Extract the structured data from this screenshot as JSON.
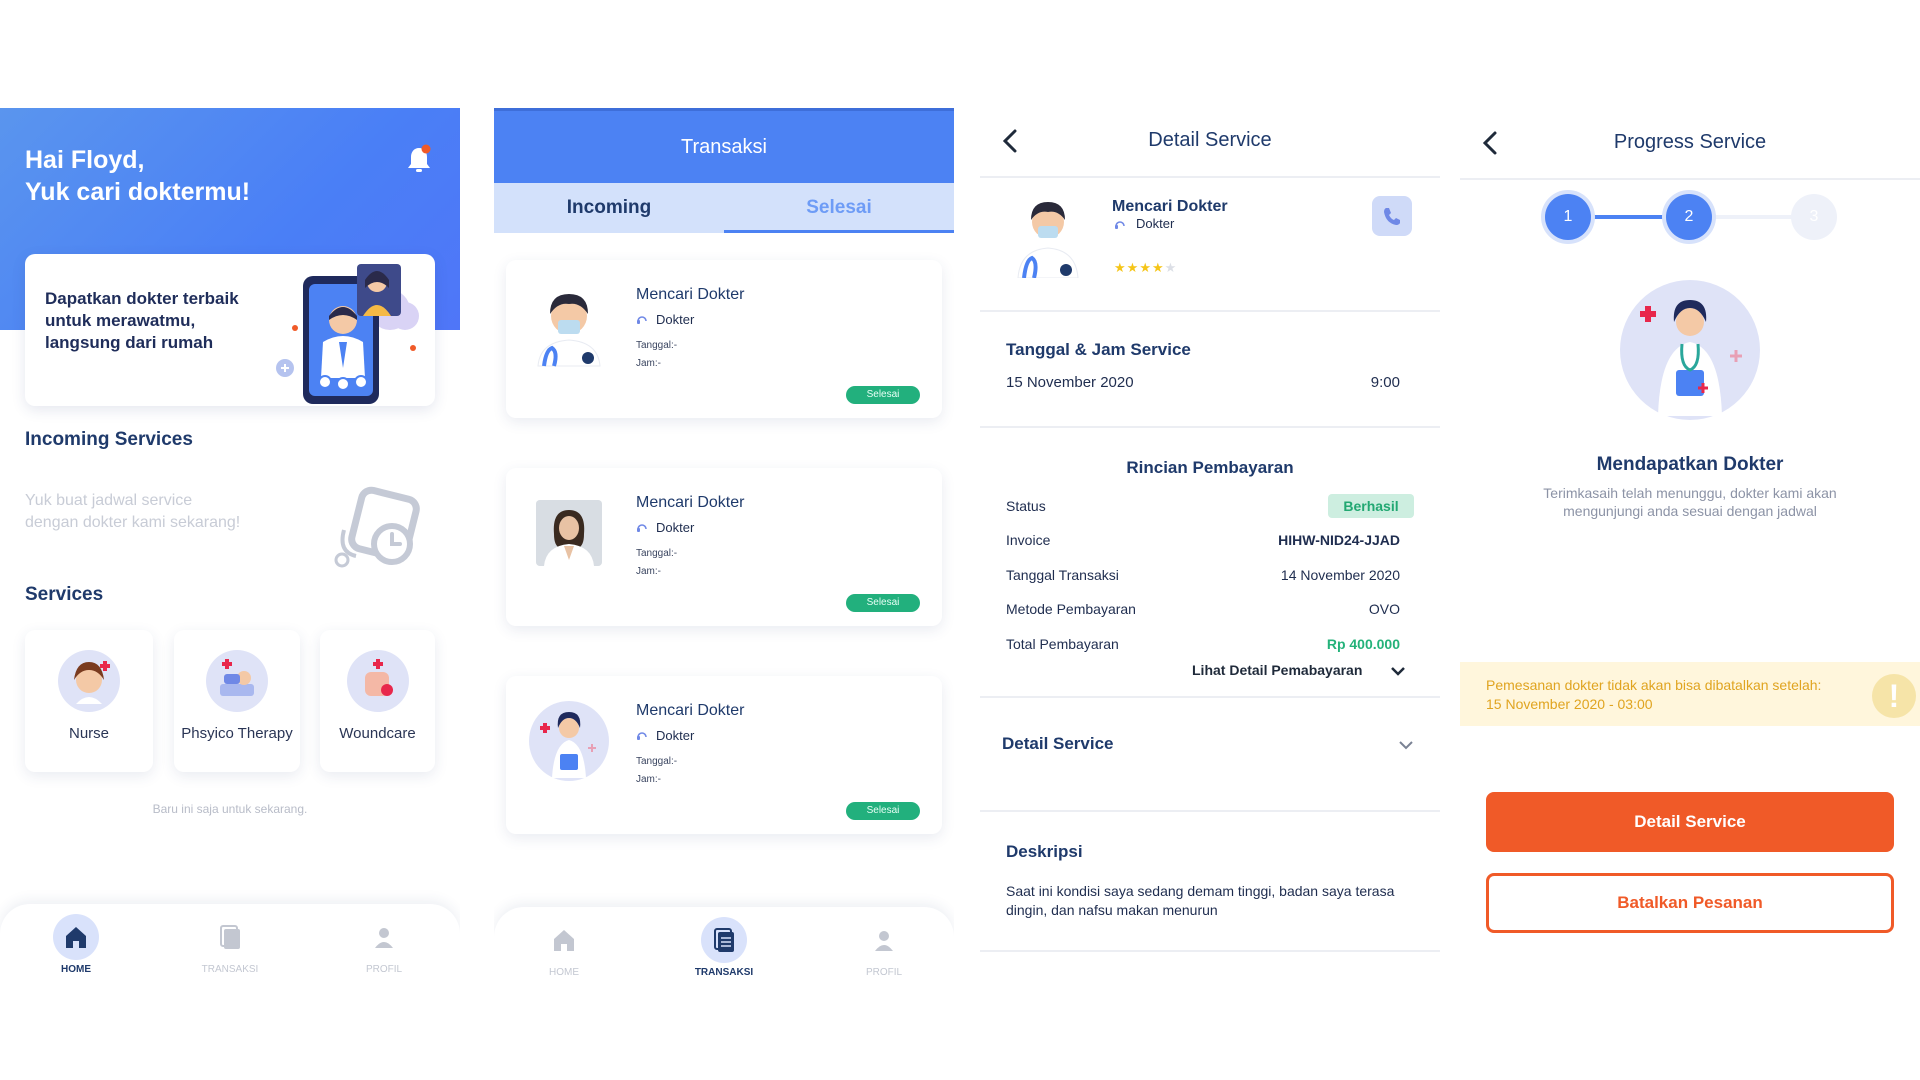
{
  "home": {
    "greeting_line1": "Hai Floyd,",
    "greeting_line2": "Yuk cari doktermu!",
    "promo_text": "Dapatkan dokter terbaik untuk merawatmu, langsung dari rumah",
    "incoming_title": "Incoming Services",
    "incoming_empty": "Yuk buat jadwal service dengan dokter kami sekarang!",
    "services_title": "Services",
    "services": [
      {
        "label": "Nurse",
        "icon": "nurse-icon"
      },
      {
        "label": "Phsyico Therapy",
        "icon": "physio-icon"
      },
      {
        "label": "Woundcare",
        "icon": "woundcare-icon"
      }
    ],
    "footnote": "Baru ini saja untuk sekarang.",
    "nav": {
      "home": "HOME",
      "transaksi": "TRANSAKSI",
      "profil": "PROFIL"
    },
    "notification_color": "#f05a28"
  },
  "transaksi": {
    "title": "Transaksi",
    "tab_incoming": "Incoming",
    "tab_selesai": "Selesai",
    "cards": [
      {
        "title": "Mencari Dokter",
        "role": "Dokter",
        "date": "Tanggal:-",
        "time": "Jam:-",
        "status": "Selesai"
      },
      {
        "title": "Mencari Dokter",
        "role": "Dokter",
        "date": "Tanggal:-",
        "time": "Jam:-",
        "status": "Selesai"
      },
      {
        "title": "Mencari Dokter",
        "role": "Dokter",
        "date": "Tanggal:-",
        "time": "Jam:-",
        "status": "Selesai"
      }
    ],
    "nav": {
      "home": "HOME",
      "transaksi": "TRANSAKSI",
      "profil": "PROFIL"
    }
  },
  "detail": {
    "title": "Detail  Service",
    "doctor_name": "Mencari Dokter",
    "doctor_role": "Dokter",
    "rating": 4,
    "rating_max": 5,
    "schedule_title": "Tanggal & Jam Service",
    "schedule_date": "15 November 2020",
    "schedule_time": "9:00",
    "payment_title": "Rincian Pembayaran",
    "rows": [
      {
        "label": "Status",
        "value": "Berhasil"
      },
      {
        "label": "Invoice",
        "value": "HIHW-NID24-JJAD"
      },
      {
        "label": "Tanggal Transaksi",
        "value": "14 November 2020"
      },
      {
        "label": "Metode Pembayaran",
        "value": "OVO"
      },
      {
        "label": "Total Pembayaran",
        "value": "Rp 400.000"
      }
    ],
    "payment_detail_link": "Lihat Detail Pemabayaran",
    "detail_service_title": "Detail Service",
    "description_title": "Deskripsi",
    "description": "Saat ini kondisi saya sedang demam tinggi, badan saya terasa dingin, dan nafsu makan menurun",
    "status_color": "#24b27a"
  },
  "progress": {
    "title": "Progress Service",
    "steps": [
      "1",
      "2",
      "3"
    ],
    "current_step": 2,
    "status_title": "Mendapatkan Dokter",
    "status_sub": "Terimkasaih telah menunggu, dokter kami akan mengunjungi anda sesuai dengan jadwal",
    "warning_line1": "Pemesanan dokter tidak akan bisa dibatalkan setelah:",
    "warning_line2": "15 November 2020 - 03:00",
    "btn_detail": "Detail Service",
    "btn_cancel": "Batalkan Pesanan",
    "accent_color": "#f05a28"
  }
}
